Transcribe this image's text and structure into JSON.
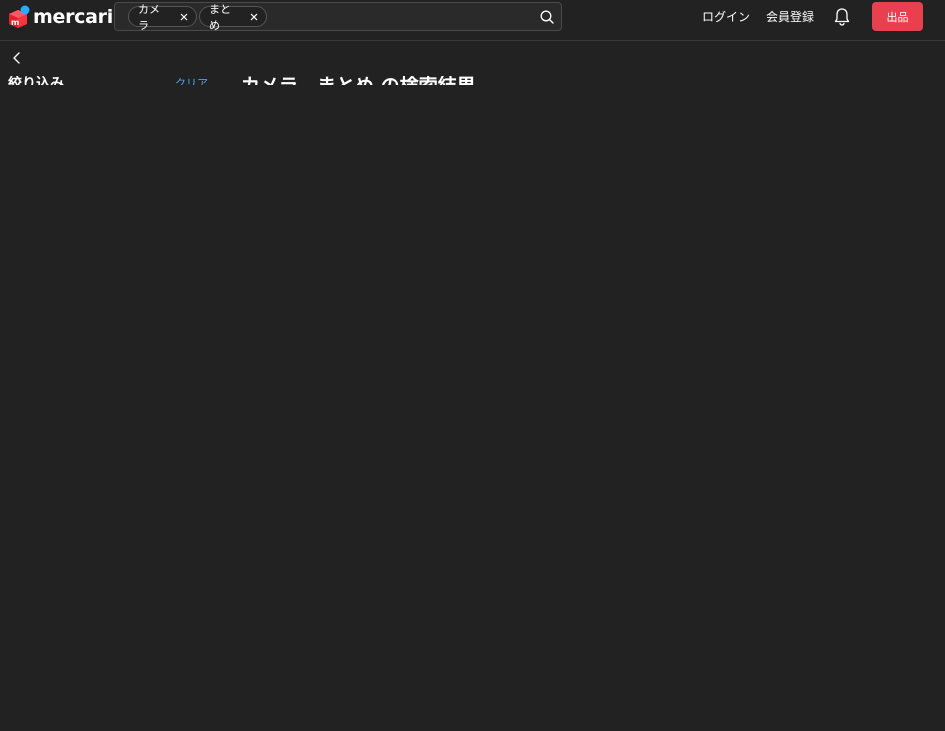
{
  "header": {
    "logo_text": "mercari",
    "search": {
      "chips": [
        {
          "label": "カメラ"
        },
        {
          "label": "まとめ"
        }
      ]
    },
    "login_label": "ログイン",
    "signup_label": "会員登録",
    "sell_label": "出品"
  },
  "sidebar": {
    "filter_title": "絞り込み",
    "clear_label": "クリア"
  },
  "main": {
    "results_title": "カメラ　まとめ の検索結果"
  },
  "colors": {
    "background": "#222222",
    "accent_red": "#e8404f",
    "link_blue": "#4aa7e8",
    "logo_red": "#ff333f",
    "logo_blue": "#2fa8ff"
  },
  "icons": [
    "mercari-logo-icon",
    "close-icon",
    "search-icon",
    "bell-icon",
    "chevron-left-icon"
  ]
}
